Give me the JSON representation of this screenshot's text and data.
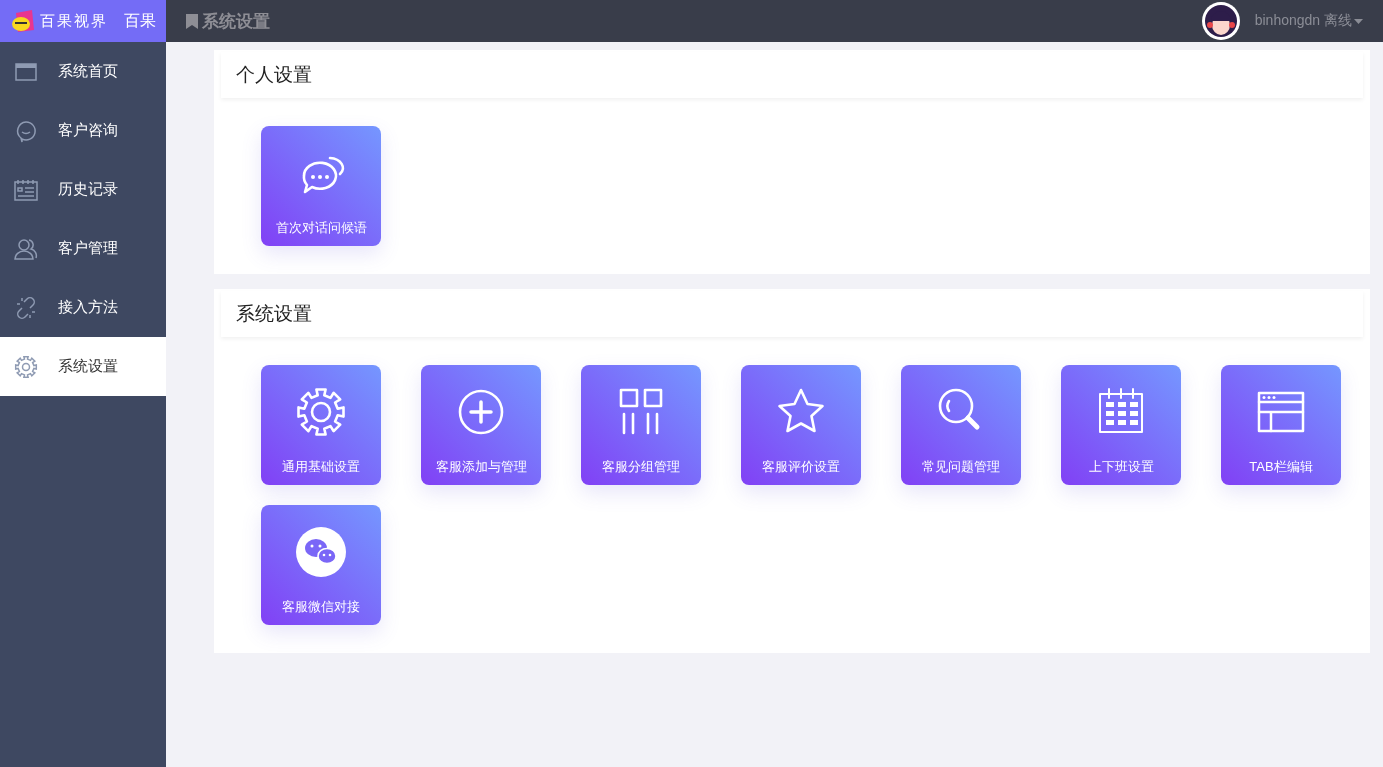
{
  "brand": {
    "name": "百果视界",
    "short": "百果"
  },
  "header": {
    "title": "系统设置",
    "user": "binhongdn",
    "status": "离线"
  },
  "sidebar": {
    "items": [
      {
        "label": "系统首页",
        "kind": "window",
        "selected": false
      },
      {
        "label": "客户咨询",
        "kind": "chat",
        "selected": false
      },
      {
        "label": "历史记录",
        "kind": "history",
        "selected": false
      },
      {
        "label": "客户管理",
        "kind": "users",
        "selected": false
      },
      {
        "label": "接入方法",
        "kind": "link",
        "selected": false
      },
      {
        "label": "系统设置",
        "kind": "gear",
        "selected": true
      }
    ]
  },
  "sections": [
    {
      "title": "个人设置",
      "cards": [
        {
          "label": "首次对话问候语",
          "kind": "bubbles"
        }
      ]
    },
    {
      "title": "系统设置",
      "cards": [
        {
          "label": "通用基础设置",
          "kind": "gear"
        },
        {
          "label": "客服添加与管理",
          "kind": "plus"
        },
        {
          "label": "客服分组管理",
          "kind": "grid"
        },
        {
          "label": "客服评价设置",
          "kind": "star"
        },
        {
          "label": "常见问题管理",
          "kind": "search"
        },
        {
          "label": "上下班设置",
          "kind": "calendar"
        },
        {
          "label": "TAB栏编辑",
          "kind": "tabs"
        },
        {
          "label": "客服微信对接",
          "kind": "wechat"
        }
      ]
    }
  ]
}
